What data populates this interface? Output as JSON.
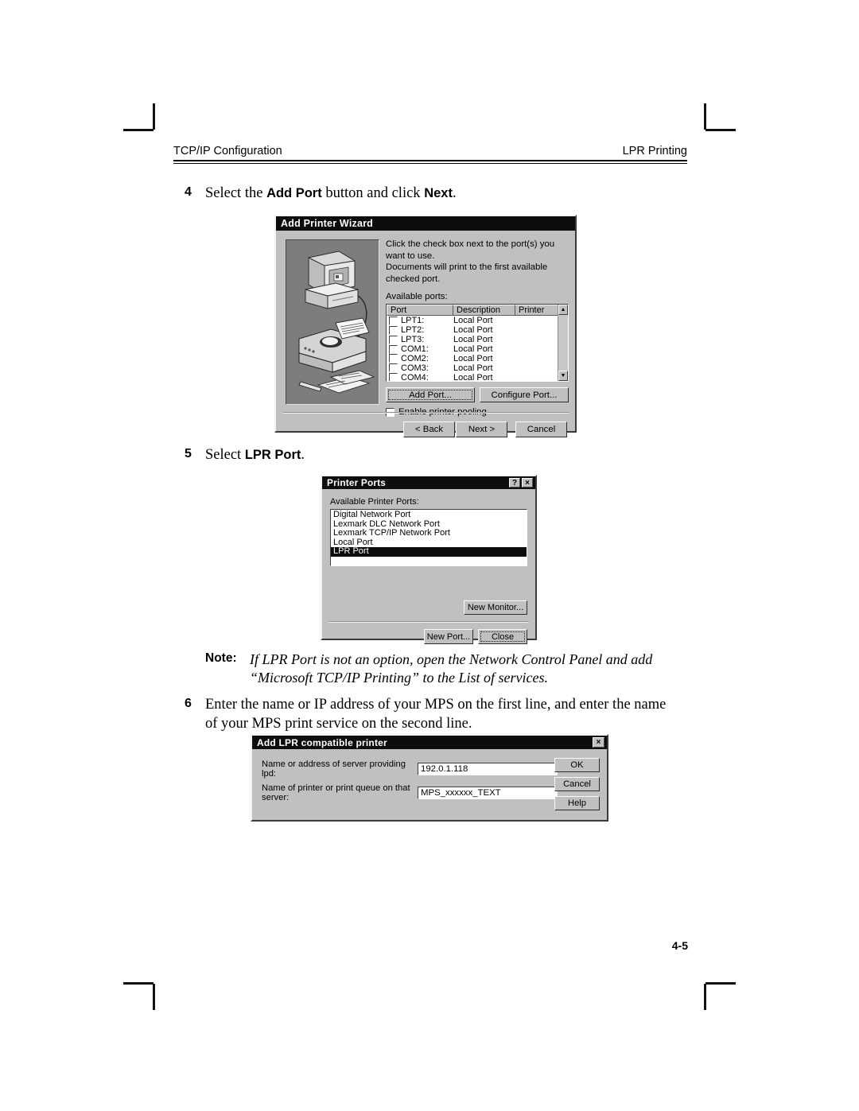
{
  "header": {
    "left": "TCP/IP Configuration",
    "right": "LPR Printing"
  },
  "page_number": "4-5",
  "steps": [
    {
      "num": "4",
      "parts": [
        {
          "t": "Select the ",
          "b": false
        },
        {
          "t": "Add Port",
          "b": true
        },
        {
          "t": " button and click ",
          "b": false
        },
        {
          "t": "Next",
          "b": true
        },
        {
          "t": ".",
          "b": false
        }
      ]
    },
    {
      "num": "5",
      "parts": [
        {
          "t": "Select ",
          "b": false
        },
        {
          "t": "LPR Port",
          "b": true
        },
        {
          "t": ".",
          "b": false
        }
      ]
    },
    {
      "num": "6",
      "parts": [
        {
          "t": "Enter the name or IP address of your MPS on the first line, and enter the name of your MPS print service on the second line.",
          "b": false
        }
      ]
    }
  ],
  "note": {
    "label": "Note:",
    "line1": "If LPR Port is not an option, open the Network Control Panel and add",
    "line2": "“Microsoft TCP/IP Printing” to the List of services."
  },
  "wizard": {
    "title": "Add Printer Wizard",
    "instruction_line1": "Click the check box next to the port(s) you want to use.",
    "instruction_line2": "Documents will print to the first available checked port.",
    "available_ports_label": "Available ports:",
    "columns": [
      "Port",
      "Description",
      "Printer"
    ],
    "rows": [
      {
        "port": "LPT1:",
        "description": "Local Port",
        "printer": "",
        "checked": false
      },
      {
        "port": "LPT2:",
        "description": "Local Port",
        "printer": "",
        "checked": false
      },
      {
        "port": "LPT3:",
        "description": "Local Port",
        "printer": "",
        "checked": false
      },
      {
        "port": "COM1:",
        "description": "Local Port",
        "printer": "",
        "checked": false
      },
      {
        "port": "COM2:",
        "description": "Local Port",
        "printer": "",
        "checked": false
      },
      {
        "port": "COM3:",
        "description": "Local Port",
        "printer": "",
        "checked": false
      },
      {
        "port": "COM4:",
        "description": "Local Port",
        "printer": "",
        "checked": false
      }
    ],
    "scroll_up_icon": "▲",
    "scroll_down_icon": "▼",
    "add_port_button": "Add Port...",
    "configure_port_button": "Configure Port...",
    "enable_pooling_label": "Enable printer pooling",
    "enable_pooling_checked": false,
    "back_button": "< Back",
    "next_button": "Next >",
    "cancel_button": "Cancel"
  },
  "printer_ports": {
    "title": "Printer Ports",
    "help_button": "?",
    "close_button": "×",
    "available_label": "Available Printer Ports:",
    "items": [
      "Digital Network Port",
      "Lexmark DLC Network Port",
      "Lexmark TCP/IP Network Port",
      "Local Port",
      "LPR Port"
    ],
    "selected_index": 4,
    "new_monitor_button": "New Monitor...",
    "new_port_button": "New Port...",
    "close_label": "Close"
  },
  "add_lpr": {
    "title": "Add LPR compatible printer",
    "close_button": "×",
    "server_label": "Name or address of server providing lpd:",
    "server_value": "192.0.1.118",
    "queue_label": "Name of printer or print queue on that server:",
    "queue_value": "MPS_xxxxxx_TEXT",
    "ok_button": "OK",
    "cancel_button": "Cancel",
    "help_button": "Help"
  }
}
